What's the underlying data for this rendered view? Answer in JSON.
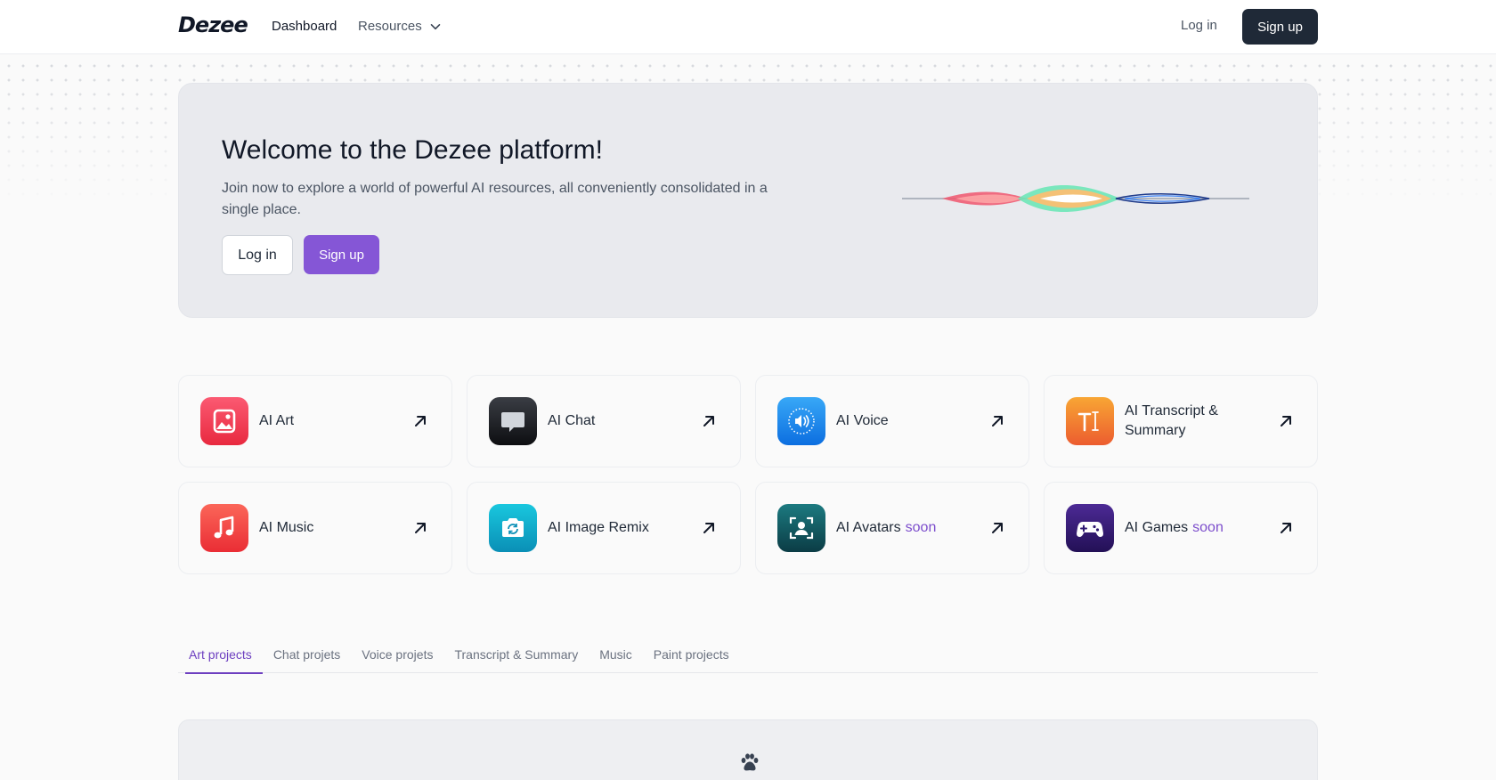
{
  "header": {
    "logo": "Dezee",
    "nav": {
      "dashboard": "Dashboard",
      "resources": "Resources"
    },
    "login": "Log in",
    "signup": "Sign up"
  },
  "hero": {
    "title": "Welcome to the Dezee platform!",
    "subtitle": "Join now to explore a world of powerful AI resources, all conveniently consolidated in a single place.",
    "login": "Log in",
    "signup": "Sign up"
  },
  "tools": [
    {
      "label": "AI Art",
      "soon": "",
      "icon": "image-icon",
      "gradient": [
        "#fb5a72",
        "#e8293f"
      ]
    },
    {
      "label": "AI Chat",
      "soon": "",
      "icon": "chat-bubble-icon",
      "gradient": [
        "#3a3d44",
        "#0d0e11"
      ]
    },
    {
      "label": "AI Voice",
      "soon": "",
      "icon": "speaker-icon",
      "gradient": [
        "#38a8f7",
        "#0c6ee0"
      ]
    },
    {
      "label": "AI Transcript & Summary",
      "soon": "",
      "icon": "text-cursor-icon",
      "gradient": [
        "#f8a634",
        "#ec5c2f"
      ]
    },
    {
      "label": "AI Music",
      "soon": "",
      "icon": "music-note-icon",
      "gradient": [
        "#fb6659",
        "#ea2d35"
      ]
    },
    {
      "label": "AI Image Remix",
      "soon": "",
      "icon": "camera-rotate-icon",
      "gradient": [
        "#19c7de",
        "#0a8fb6"
      ]
    },
    {
      "label": "AI Avatars",
      "soon": "soon",
      "icon": "face-scan-icon",
      "gradient": [
        "#1c7a80",
        "#0b3c45"
      ]
    },
    {
      "label": "AI Games",
      "soon": "soon",
      "icon": "gamepad-icon",
      "gradient": [
        "#4c2a95",
        "#231056"
      ]
    }
  ],
  "tabs": [
    {
      "label": "Art projects",
      "active": true
    },
    {
      "label": "Chat projets",
      "active": false
    },
    {
      "label": "Voice projets",
      "active": false
    },
    {
      "label": "Transcript & Summary",
      "active": false
    },
    {
      "label": "Music",
      "active": false
    },
    {
      "label": "Paint projects",
      "active": false
    }
  ],
  "colors": {
    "accent": "#8556d6",
    "dark_button": "#1f2937",
    "hero_bg": "#e9eaee"
  }
}
